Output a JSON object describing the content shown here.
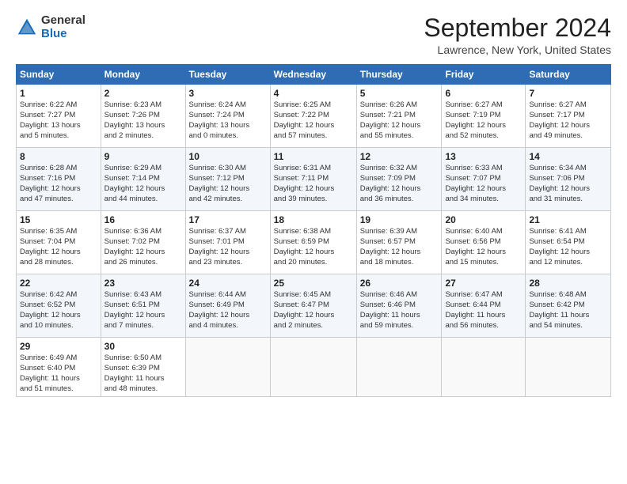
{
  "logo": {
    "general": "General",
    "blue": "Blue"
  },
  "title": "September 2024",
  "subtitle": "Lawrence, New York, United States",
  "days_header": [
    "Sunday",
    "Monday",
    "Tuesday",
    "Wednesday",
    "Thursday",
    "Friday",
    "Saturday"
  ],
  "weeks": [
    [
      {
        "day": "1",
        "info": "Sunrise: 6:22 AM\nSunset: 7:27 PM\nDaylight: 13 hours\nand 5 minutes."
      },
      {
        "day": "2",
        "info": "Sunrise: 6:23 AM\nSunset: 7:26 PM\nDaylight: 13 hours\nand 2 minutes."
      },
      {
        "day": "3",
        "info": "Sunrise: 6:24 AM\nSunset: 7:24 PM\nDaylight: 13 hours\nand 0 minutes."
      },
      {
        "day": "4",
        "info": "Sunrise: 6:25 AM\nSunset: 7:22 PM\nDaylight: 12 hours\nand 57 minutes."
      },
      {
        "day": "5",
        "info": "Sunrise: 6:26 AM\nSunset: 7:21 PM\nDaylight: 12 hours\nand 55 minutes."
      },
      {
        "day": "6",
        "info": "Sunrise: 6:27 AM\nSunset: 7:19 PM\nDaylight: 12 hours\nand 52 minutes."
      },
      {
        "day": "7",
        "info": "Sunrise: 6:27 AM\nSunset: 7:17 PM\nDaylight: 12 hours\nand 49 minutes."
      }
    ],
    [
      {
        "day": "8",
        "info": "Sunrise: 6:28 AM\nSunset: 7:16 PM\nDaylight: 12 hours\nand 47 minutes."
      },
      {
        "day": "9",
        "info": "Sunrise: 6:29 AM\nSunset: 7:14 PM\nDaylight: 12 hours\nand 44 minutes."
      },
      {
        "day": "10",
        "info": "Sunrise: 6:30 AM\nSunset: 7:12 PM\nDaylight: 12 hours\nand 42 minutes."
      },
      {
        "day": "11",
        "info": "Sunrise: 6:31 AM\nSunset: 7:11 PM\nDaylight: 12 hours\nand 39 minutes."
      },
      {
        "day": "12",
        "info": "Sunrise: 6:32 AM\nSunset: 7:09 PM\nDaylight: 12 hours\nand 36 minutes."
      },
      {
        "day": "13",
        "info": "Sunrise: 6:33 AM\nSunset: 7:07 PM\nDaylight: 12 hours\nand 34 minutes."
      },
      {
        "day": "14",
        "info": "Sunrise: 6:34 AM\nSunset: 7:06 PM\nDaylight: 12 hours\nand 31 minutes."
      }
    ],
    [
      {
        "day": "15",
        "info": "Sunrise: 6:35 AM\nSunset: 7:04 PM\nDaylight: 12 hours\nand 28 minutes."
      },
      {
        "day": "16",
        "info": "Sunrise: 6:36 AM\nSunset: 7:02 PM\nDaylight: 12 hours\nand 26 minutes."
      },
      {
        "day": "17",
        "info": "Sunrise: 6:37 AM\nSunset: 7:01 PM\nDaylight: 12 hours\nand 23 minutes."
      },
      {
        "day": "18",
        "info": "Sunrise: 6:38 AM\nSunset: 6:59 PM\nDaylight: 12 hours\nand 20 minutes."
      },
      {
        "day": "19",
        "info": "Sunrise: 6:39 AM\nSunset: 6:57 PM\nDaylight: 12 hours\nand 18 minutes."
      },
      {
        "day": "20",
        "info": "Sunrise: 6:40 AM\nSunset: 6:56 PM\nDaylight: 12 hours\nand 15 minutes."
      },
      {
        "day": "21",
        "info": "Sunrise: 6:41 AM\nSunset: 6:54 PM\nDaylight: 12 hours\nand 12 minutes."
      }
    ],
    [
      {
        "day": "22",
        "info": "Sunrise: 6:42 AM\nSunset: 6:52 PM\nDaylight: 12 hours\nand 10 minutes."
      },
      {
        "day": "23",
        "info": "Sunrise: 6:43 AM\nSunset: 6:51 PM\nDaylight: 12 hours\nand 7 minutes."
      },
      {
        "day": "24",
        "info": "Sunrise: 6:44 AM\nSunset: 6:49 PM\nDaylight: 12 hours\nand 4 minutes."
      },
      {
        "day": "25",
        "info": "Sunrise: 6:45 AM\nSunset: 6:47 PM\nDaylight: 12 hours\nand 2 minutes."
      },
      {
        "day": "26",
        "info": "Sunrise: 6:46 AM\nSunset: 6:46 PM\nDaylight: 11 hours\nand 59 minutes."
      },
      {
        "day": "27",
        "info": "Sunrise: 6:47 AM\nSunset: 6:44 PM\nDaylight: 11 hours\nand 56 minutes."
      },
      {
        "day": "28",
        "info": "Sunrise: 6:48 AM\nSunset: 6:42 PM\nDaylight: 11 hours\nand 54 minutes."
      }
    ],
    [
      {
        "day": "29",
        "info": "Sunrise: 6:49 AM\nSunset: 6:40 PM\nDaylight: 11 hours\nand 51 minutes."
      },
      {
        "day": "30",
        "info": "Sunrise: 6:50 AM\nSunset: 6:39 PM\nDaylight: 11 hours\nand 48 minutes."
      },
      {
        "day": "",
        "info": ""
      },
      {
        "day": "",
        "info": ""
      },
      {
        "day": "",
        "info": ""
      },
      {
        "day": "",
        "info": ""
      },
      {
        "day": "",
        "info": ""
      }
    ]
  ]
}
